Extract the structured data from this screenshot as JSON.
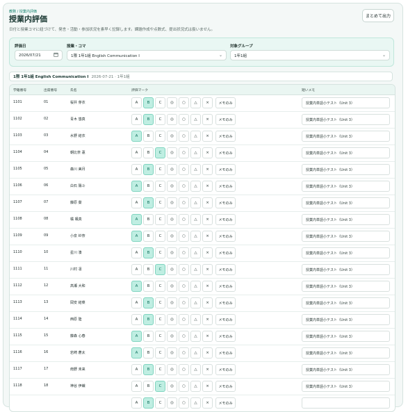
{
  "header": {
    "breadcrumb": "教務 / 授業内評価",
    "title": "授業内評価",
    "description": "日付と授業コマに紐づけて、発言・活動・参加状況を素早く記録します。課題作成や点数式、提出状況式は扱いません。",
    "export_label": "まとめて出力"
  },
  "filters": {
    "date_label": "評価日",
    "date_value": "2026/07/21",
    "lesson_label": "授業・コマ",
    "lesson_value": "1限 1年1組 English Communication I",
    "group_label": "対象グループ",
    "group_value": "1年1組"
  },
  "session": {
    "title": "1限 1年1組 English Communication I",
    "meta": "2026-07-21 · 1年1組"
  },
  "table": {
    "headers": {
      "student_id": "学籍番号",
      "seat": "出席番号",
      "name": "氏名",
      "mark": "評価マーク",
      "memo": "短いメモ"
    },
    "mark_options": [
      "A",
      "B",
      "C",
      "◎",
      "○",
      "△",
      "×"
    ],
    "memo_only_label": "メモのみ",
    "rows": [
      {
        "id": "1101",
        "seat": "01",
        "name": "桜井 芽衣",
        "mark": "B",
        "memo": "授業内単語小テスト（Unit 3）"
      },
      {
        "id": "1102",
        "seat": "02",
        "name": "青木 悠真",
        "mark": "B",
        "memo": "授業内単語小テスト（Unit 3）"
      },
      {
        "id": "1103",
        "seat": "03",
        "name": "水野 結衣",
        "mark": "A",
        "memo": "授業内単語小テスト（Unit 3）"
      },
      {
        "id": "1104",
        "seat": "04",
        "name": "朝比奈 蓮",
        "mark": "C",
        "memo": "授業内単語小テスト（Unit 3）"
      },
      {
        "id": "1105",
        "seat": "05",
        "name": "森川 美月",
        "mark": "B",
        "memo": "授業内単語小テスト（Unit 3）"
      },
      {
        "id": "1106",
        "seat": "06",
        "name": "白石 陽斗",
        "mark": "A",
        "memo": "授業内単語小テスト（Unit 3）"
      },
      {
        "id": "1107",
        "seat": "07",
        "name": "藤原 葵",
        "mark": "B",
        "memo": "授業内単語小テスト（Unit 3）"
      },
      {
        "id": "1108",
        "seat": "08",
        "name": "橘 颯真",
        "mark": "A",
        "memo": "授業内単語小テスト（Unit 3）"
      },
      {
        "id": "1109",
        "seat": "09",
        "name": "小泉 紗奈",
        "mark": "A",
        "memo": "授業内単語小テスト（Unit 3）"
      },
      {
        "id": "1110",
        "seat": "10",
        "name": "星川 湊",
        "mark": "B",
        "memo": "授業内単語小テスト（Unit 3）"
      },
      {
        "id": "1111",
        "seat": "11",
        "name": "川村 凛",
        "mark": "C",
        "memo": "授業内単語小テスト（Unit 3）"
      },
      {
        "id": "1112",
        "seat": "12",
        "name": "高瀬 大和",
        "mark": "A",
        "memo": "授業内単語小テスト（Unit 3）"
      },
      {
        "id": "1113",
        "seat": "13",
        "name": "岡安 結菜",
        "mark": "B",
        "memo": "授業内単語小テスト（Unit 3）"
      },
      {
        "id": "1114",
        "seat": "14",
        "name": "西原 陸",
        "mark": "B",
        "memo": "授業内単語小テスト（Unit 3）"
      },
      {
        "id": "1115",
        "seat": "15",
        "name": "藤森 心春",
        "mark": "A",
        "memo": "授業内単語小テスト（Unit 3）"
      },
      {
        "id": "1116",
        "seat": "16",
        "name": "岩崎 蒼太",
        "mark": "A",
        "memo": "授業内単語小テスト（Unit 3）"
      },
      {
        "id": "1117",
        "seat": "17",
        "name": "南野 未来",
        "mark": "B",
        "memo": "授業内単語小テスト（Unit 3）"
      },
      {
        "id": "1118",
        "seat": "18",
        "name": "神谷 伊織",
        "mark": "C",
        "memo": "授業内単語小テスト（Unit 3）"
      },
      {
        "id": "",
        "seat": "",
        "name": "",
        "mark": "B",
        "memo": ""
      }
    ]
  },
  "icons": {
    "calendar": "calendar-icon",
    "chevron": "chevron-down-icon"
  },
  "colors": {
    "accent": "#10806c",
    "selected_bg": "#bfeee2",
    "filter_bg": "#e9f7f3"
  }
}
